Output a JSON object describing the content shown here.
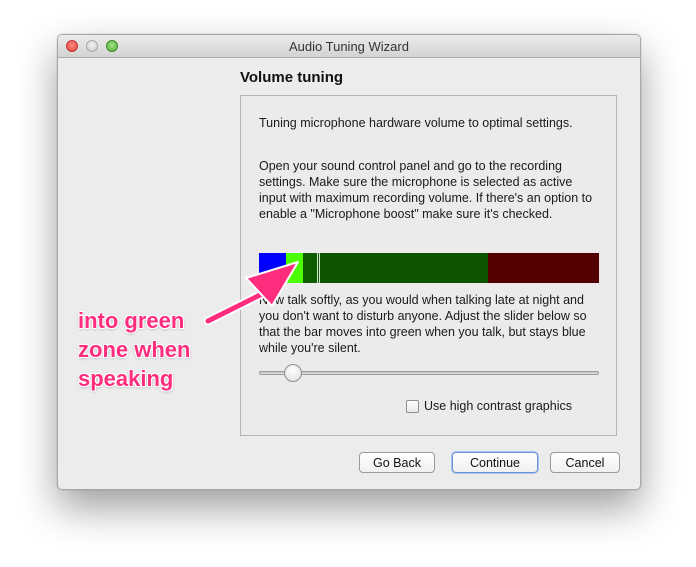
{
  "window": {
    "title": "Audio Tuning Wizard"
  },
  "page": {
    "heading": "Volume tuning",
    "intro": "Tuning microphone hardware volume to optimal settings.",
    "instructions": "Open your sound control panel and go to the recording settings. Make sure the microphone is selected as active input with maximum recording volume. If there's an option to enable a \"Microphone boost\" make sure it's checked.",
    "talk_instructions": "Now talk softly, as you would when talking late at night and you don't want to disturb anyone. Adjust the slider below so that the bar moves into green when you talk, but stays blue while you're silent."
  },
  "meter": {
    "zones": [
      {
        "name": "silence",
        "color": "#0000ff",
        "share": 0.08
      },
      {
        "name": "current-level",
        "color": "#4cff00",
        "share": 0.05
      },
      {
        "name": "speech-low",
        "color": "#0e5c00",
        "share": 0.05
      },
      {
        "name": "speech",
        "color": "#0e5400",
        "share": 0.495
      },
      {
        "name": "too-loud",
        "color": "#520000",
        "share": 0.325
      }
    ]
  },
  "slider": {
    "value": 0.1
  },
  "options": {
    "high_contrast_label": "Use high contrast graphics",
    "high_contrast_checked": false
  },
  "buttons": {
    "back": "Go Back",
    "continue": "Continue",
    "cancel": "Cancel"
  },
  "annotation": {
    "lines": [
      "into green",
      "zone when",
      "speaking"
    ],
    "color": "#ff2d7e"
  }
}
